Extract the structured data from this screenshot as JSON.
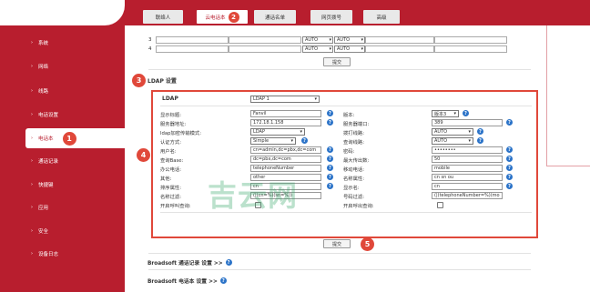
{
  "sidebar": {
    "items": [
      {
        "label": "系统"
      },
      {
        "label": "网络"
      },
      {
        "label": "线路"
      },
      {
        "label": "电话设置"
      },
      {
        "label": "电话本"
      },
      {
        "label": "通话记录"
      },
      {
        "label": "快捷键"
      },
      {
        "label": "应用"
      },
      {
        "label": "安全"
      },
      {
        "label": "设备日志"
      }
    ],
    "active_badge": "1"
  },
  "tabs": [
    {
      "label": "联络人"
    },
    {
      "label": "云电话本"
    },
    {
      "label": "通话名单"
    },
    {
      "label": "网页拨号"
    },
    {
      "label": "高级"
    }
  ],
  "tab_badge": "2",
  "phonebook_rows": [
    {
      "index": "3",
      "sel1": "AUTO",
      "sel2": "AUTO"
    },
    {
      "index": "4",
      "sel1": "AUTO",
      "sel2": "AUTO"
    }
  ],
  "submit_label": "提交",
  "ldap": {
    "section_badge": "3",
    "section_title": "LDAP 设置",
    "box_badge": "4",
    "header_label": "LDAP",
    "header_value": "LDAP 1",
    "left": [
      {
        "label": "显示标题:",
        "value": "Fanvil",
        "type": "input"
      },
      {
        "label": "服务器地址:",
        "value": "172.18.1.158",
        "type": "input"
      },
      {
        "label": "ldap加密传输模式:",
        "value": "LDAP",
        "type": "select"
      },
      {
        "label": "认证方式:",
        "value": "Simple",
        "type": "select"
      },
      {
        "label": "用户名:",
        "value": "cn=admin,dc=pbx,dc=com",
        "type": "input"
      },
      {
        "label": "查询Base:",
        "value": "dc=pbx,dc=com",
        "type": "input"
      },
      {
        "label": "办公电话:",
        "value": "telephoneNumber",
        "type": "input"
      },
      {
        "label": "其他:",
        "value": "other",
        "type": "input"
      },
      {
        "label": "排序属性:",
        "value": "cn",
        "type": "input"
      },
      {
        "label": "名称过滤:",
        "value": "(|(cn=%)(sn=%))",
        "type": "input"
      },
      {
        "label": "开启呼叫查询:",
        "value": "",
        "type": "checkbox"
      }
    ],
    "right": [
      {
        "label": "版本:",
        "value": "版本3",
        "type": "select"
      },
      {
        "label": "服务器端口:",
        "value": "389",
        "type": "input"
      },
      {
        "label": "拨打线路:",
        "value": "AUTO",
        "type": "select"
      },
      {
        "label": "查询线路:",
        "value": "AUTO",
        "type": "select"
      },
      {
        "label": "密码:",
        "value": "••••••••",
        "type": "input"
      },
      {
        "label": "最大传出数:",
        "value": "50",
        "type": "input"
      },
      {
        "label": "移动电话:",
        "value": "mobile",
        "type": "input"
      },
      {
        "label": "名称属性:",
        "value": "cn sn ou",
        "type": "input"
      },
      {
        "label": "显示名:",
        "value": "cn",
        "type": "input"
      },
      {
        "label": "号码过滤:",
        "value": "(|(telephoneNumber=%)(mo",
        "type": "input"
      },
      {
        "label": "开启呼出查询:",
        "value": "",
        "type": "checkbox"
      }
    ],
    "submit_label": "提交",
    "submit_badge": "5"
  },
  "broadsoft": [
    {
      "label": "Broadsoft 通话记录 设置 >>"
    },
    {
      "label": "Broadsoft 电话本 设置 >>"
    }
  ],
  "watermark": "吉云网",
  "colors": {
    "brand": "#b81e2e",
    "badge": "#e0483a",
    "help": "#2b73c8"
  }
}
